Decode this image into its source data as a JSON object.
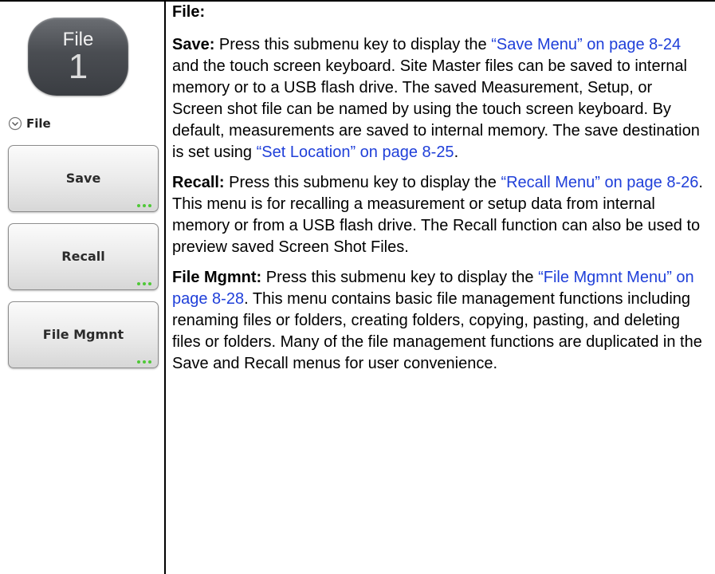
{
  "left_panel": {
    "hard_key": {
      "label": "File",
      "number": "1"
    },
    "menu_title": {
      "icon": "circle-chevron-down-icon",
      "label": "File"
    },
    "softkeys": [
      {
        "label": "Save",
        "dots": "more-options-icon"
      },
      {
        "label": "Recall",
        "dots": "more-options-icon"
      },
      {
        "label": "File Mgmnt",
        "dots": "more-options-icon"
      }
    ],
    "dot_color": "#4fc837"
  },
  "content": {
    "heading": "File:",
    "save": {
      "term": "Save:",
      "text1": "  Press this submenu key to display the ",
      "xref1": "“Save Menu” on page 8-24",
      "text2": " and the touch screen keyboard. Site Master files can be saved to internal memory or to a USB flash drive. The saved Measurement, Setup, or Screen shot file can be named by using the touch screen keyboard. By default, measurements are saved to internal memory. The save destination is set using ",
      "xref2": "“Set Location” on page 8-25",
      "text3": "."
    },
    "recall": {
      "term": "Recall:",
      "text1": "  Press this submenu key to display the ",
      "xref1": "“Recall Menu” on page 8-26",
      "text2": ". This menu is for recalling a measurement or setup data from internal memory or from a USB flash drive. The Recall function can also be used to preview saved Screen Shot Files."
    },
    "file_mgmnt": {
      "term": "File Mgmnt:",
      "text1": "  Press this submenu key to display the ",
      "xref1": "“File Mgmnt Menu” on page 8-28",
      "text2": ". This menu contains basic file management functions including renaming files or folders, creating folders, copying, pasting, and deleting files or folders. Many of the file management functions are duplicated in the Save and Recall menus for user convenience."
    },
    "link_color": "#1f3fd9"
  }
}
